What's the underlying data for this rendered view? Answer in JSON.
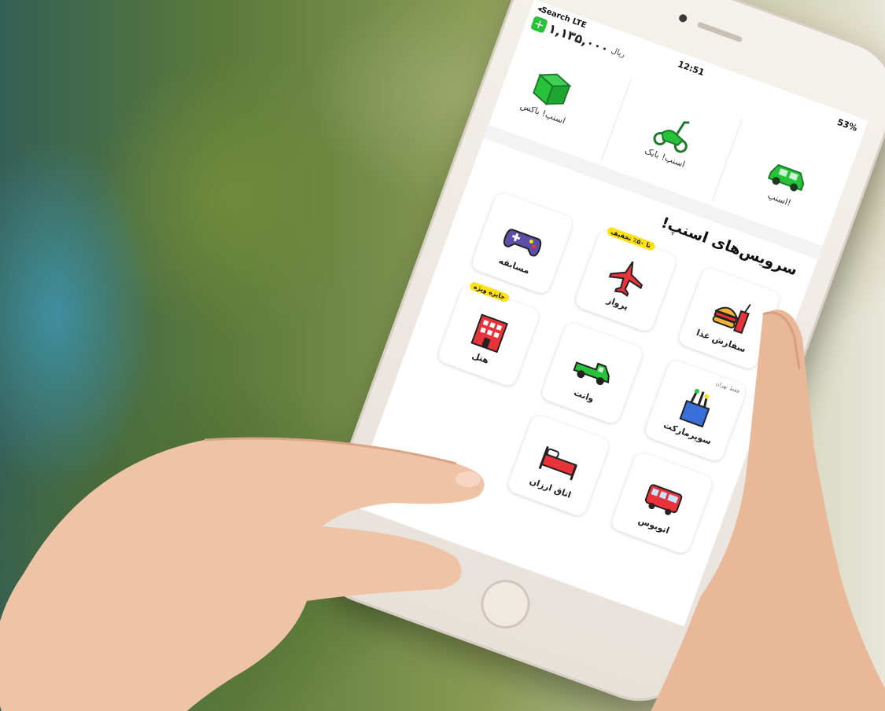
{
  "status_bar": {
    "carrier": "◂Search  LTE",
    "time": "12:51",
    "battery": "53%"
  },
  "wallet": {
    "plus": "+",
    "amount": "۱,۱۳۵,۰۰۰",
    "currency": "ریال"
  },
  "top_services": [
    {
      "label": "اسنپ!",
      "icon": "car-icon",
      "color": "#27c13a"
    },
    {
      "label": "اسنپ! بایک",
      "icon": "scooter-icon",
      "color": "#27c13a"
    },
    {
      "label": "اسنپ! باکس",
      "icon": "box-icon",
      "color": "#27c13a"
    }
  ],
  "section_title": "سرویس‌های اسنپ!",
  "services": [
    {
      "label": "سفارش غذا",
      "icon": "food-icon",
      "badge": "",
      "note": ""
    },
    {
      "label": "پرواز",
      "icon": "airplane-icon",
      "badge": "تا ۵۰٪ تخفیف",
      "note": ""
    },
    {
      "label": "مسابقه",
      "icon": "gamepad-icon",
      "badge": "",
      "note": ""
    },
    {
      "label": "سوپرمارکت",
      "icon": "grocery-icon",
      "badge": "",
      "note": "فقط تهران"
    },
    {
      "label": "وانت",
      "icon": "pickup-truck-icon",
      "badge": "",
      "note": ""
    },
    {
      "label": "هتل",
      "icon": "hotel-icon",
      "badge": "جایزه ویژه",
      "note": ""
    },
    {
      "label": "اتوبوس",
      "icon": "bus-icon",
      "badge": "",
      "note": ""
    },
    {
      "label": "اتاق ارزان",
      "icon": "bed-icon",
      "badge": "",
      "note": ""
    }
  ],
  "colors": {
    "brand_green": "#27c13a",
    "badge_yellow": "#ffe116",
    "icon_red": "#e8333a",
    "icon_purple": "#5b4fa8"
  }
}
